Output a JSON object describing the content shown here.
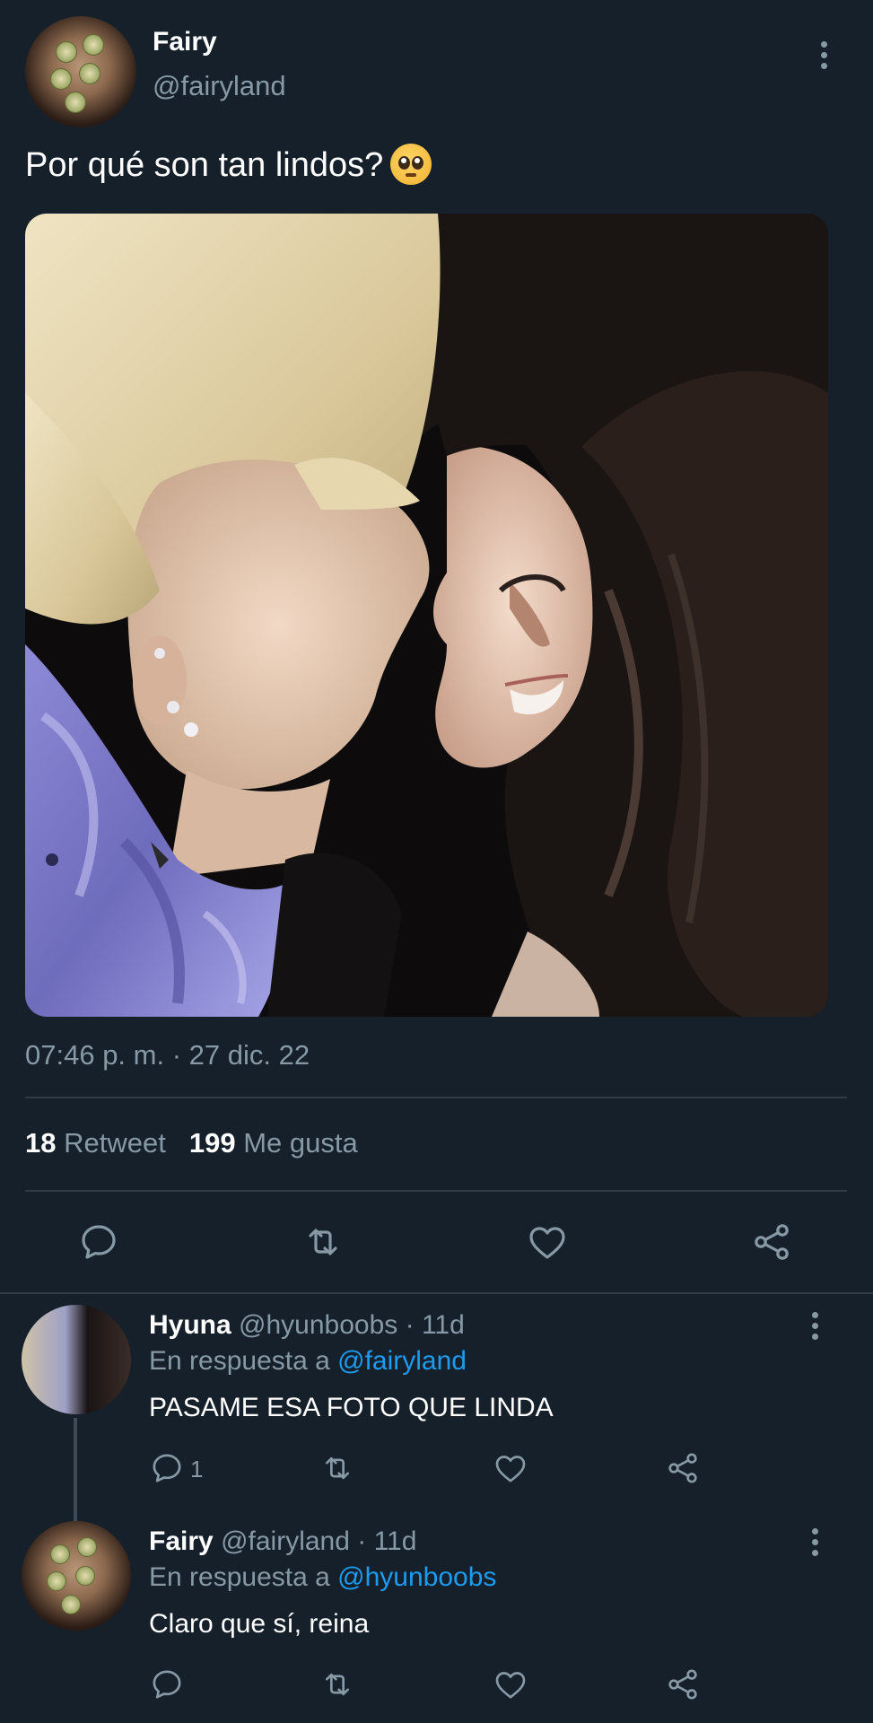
{
  "tweet": {
    "author_name": "Fairy",
    "author_handle": "@fairyland",
    "text": "Por qué son tan lindos?",
    "emoji": "pleading-face-emoji",
    "timestamp": "07:46 p. m. · 27 dic. 22",
    "retweet_count": "18",
    "retweet_label": "Retweet",
    "like_count": "199",
    "like_label": "Me gusta"
  },
  "replies": [
    {
      "name": "Hyuna",
      "handle": "@hyunboobs",
      "time": "· 11d",
      "reply_prefix": "En respuesta a",
      "reply_to": "@fairyland",
      "text": "PASAME ESA FOTO QUE LINDA",
      "reply_count": "1"
    },
    {
      "name": "Fairy",
      "handle": "@fairyland",
      "time": "· 11d",
      "reply_prefix": "En respuesta a",
      "reply_to": "@hyunboobs",
      "text": "Claro que sí, reina",
      "reply_count": ""
    }
  ],
  "icons": {
    "reply": "reply-icon",
    "retweet": "retweet-icon",
    "like": "heart-icon",
    "share": "share-icon",
    "more": "more-options-icon"
  },
  "colors": {
    "background": "#15202b",
    "secondary_text": "#8899a6",
    "mention": "#1d9bf0",
    "divider": "#2f3a45"
  }
}
